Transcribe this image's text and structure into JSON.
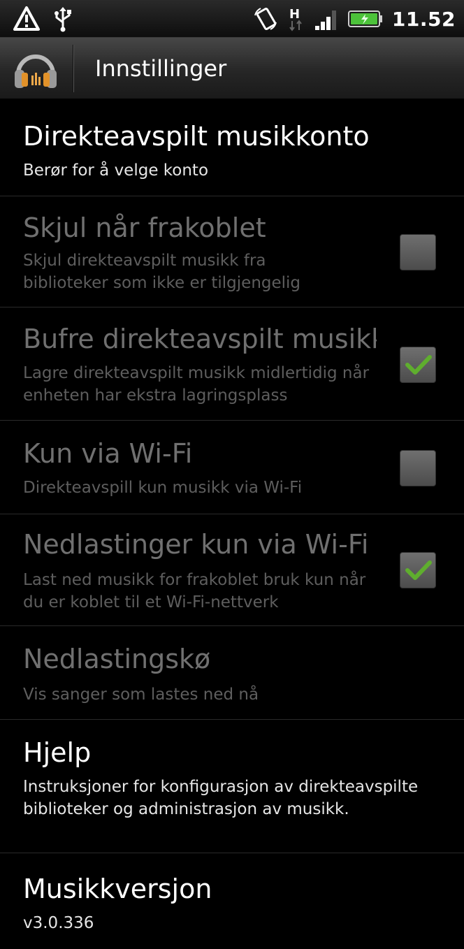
{
  "status_bar": {
    "clock": "11.52",
    "network_type": "H"
  },
  "header": {
    "title": "Innstillinger",
    "app_icon": "headphones-icon"
  },
  "settings": [
    {
      "title": "Direkteavspilt musikkonto",
      "summary": "Berør for å velge konto",
      "enabled": true,
      "has_checkbox": false
    },
    {
      "title": "Skjul når frakoblet",
      "summary": "Skjul direkteavspilt musikk fra biblioteker som ikke er tilgjengelig",
      "enabled": false,
      "has_checkbox": true,
      "checked": false
    },
    {
      "title": "Bufre direkteavspilt musikk",
      "summary": "Lagre direkteavspilt musikk midlertidig når enheten har ekstra lagringsplass",
      "enabled": false,
      "has_checkbox": true,
      "checked": true
    },
    {
      "title": "Kun via Wi-Fi",
      "summary": "Direkteavspill kun musikk via Wi-Fi",
      "enabled": false,
      "has_checkbox": true,
      "checked": false
    },
    {
      "title": "Nedlastinger kun via Wi-Fi",
      "summary": "Last ned musikk for frakoblet bruk kun når du er koblet til et Wi-Fi-nettverk",
      "enabled": false,
      "has_checkbox": true,
      "checked": true
    },
    {
      "title": "Nedlastingskø",
      "summary": "Vis sanger som lastes ned nå",
      "enabled": false,
      "has_checkbox": false
    },
    {
      "title": "Hjelp",
      "summary": "Instruksjoner for konfigurasjon av direkteavspilte biblioteker og administrasjon av musikk.",
      "enabled": true,
      "has_checkbox": false
    },
    {
      "title": "Musikkversjon",
      "summary": "v3.0.336",
      "enabled": true,
      "has_checkbox": false
    }
  ],
  "colors": {
    "check_mark": "#5fae2e",
    "battery_fill": "#4cc23a"
  }
}
